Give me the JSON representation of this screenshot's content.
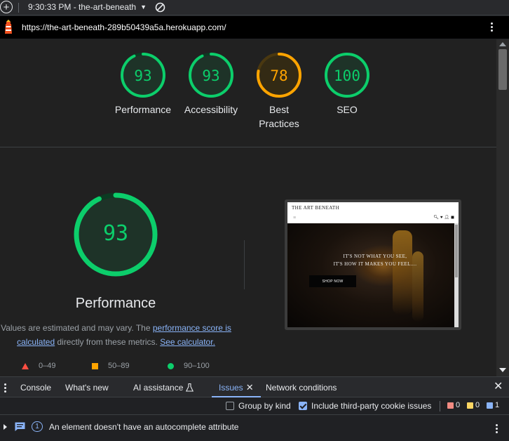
{
  "toolbar": {
    "add_label": "+",
    "report_time": "9:30:33 PM - the-art-beneath"
  },
  "url_bar": {
    "url": "https://the-art-beneath-289b50439a5a.herokuapp.com/"
  },
  "categories": [
    {
      "label": "Performance",
      "score": 93,
      "status": "pass",
      "color": "#0cce6b"
    },
    {
      "label": "Accessibility",
      "score": 93,
      "status": "pass",
      "color": "#0cce6b"
    },
    {
      "label": "Best Practices",
      "score": 78,
      "status": "average",
      "color": "#ffa400"
    },
    {
      "label": "SEO",
      "score": 100,
      "status": "pass",
      "color": "#0cce6b"
    }
  ],
  "performance": {
    "score": 93,
    "title": "Performance",
    "desc_prefix": "Values are estimated and may vary. The ",
    "desc_link1": "performance score is calculated",
    "desc_middle": " directly from these metrics. ",
    "desc_link2": "See calculator."
  },
  "legend": [
    {
      "range": "0–49",
      "shape": "triangle",
      "color": "#ff4e42"
    },
    {
      "range": "50–89",
      "shape": "square",
      "color": "#ffa400"
    },
    {
      "range": "90–100",
      "shape": "circle",
      "color": "#0cce6b"
    }
  ],
  "thumbnail": {
    "brand": "THE ART BENEATH",
    "menu_icon": "≡",
    "icons": "🔍︎♥👤︎◼",
    "headline_line1": "IT'S NOT WHAT YOU SEE,",
    "headline_line2": "IT'S HOW IT MAKES YOU FEEL....",
    "button": "SHOP NOW"
  },
  "drawer": {
    "tabs": [
      {
        "label": "Console",
        "active": false
      },
      {
        "label": "What's new",
        "active": false
      },
      {
        "label": "AI assistance",
        "active": false
      },
      {
        "label": "Issues",
        "active": true
      },
      {
        "label": "Network conditions",
        "active": false
      }
    ],
    "close_glyph": "✕"
  },
  "issues_toolbar": {
    "group_by_kind": {
      "label": "Group by kind",
      "checked": false
    },
    "third_party": {
      "label": "Include third-party cookie issues",
      "checked": true
    },
    "counts": [
      {
        "kind": "page-errors",
        "value": "0",
        "color": "#f28b82"
      },
      {
        "kind": "breaking-changes",
        "value": "0",
        "color": "#fdd663"
      },
      {
        "kind": "improvements",
        "value": "1",
        "color": "#8ab4f8"
      }
    ]
  },
  "issue": {
    "count": "1",
    "title": "An element doesn't have an autocomplete attribute"
  },
  "colors": {
    "pass": "#0cce6b",
    "average": "#ffa400",
    "fail": "#ff4e42",
    "link": "#8ab4f8"
  }
}
